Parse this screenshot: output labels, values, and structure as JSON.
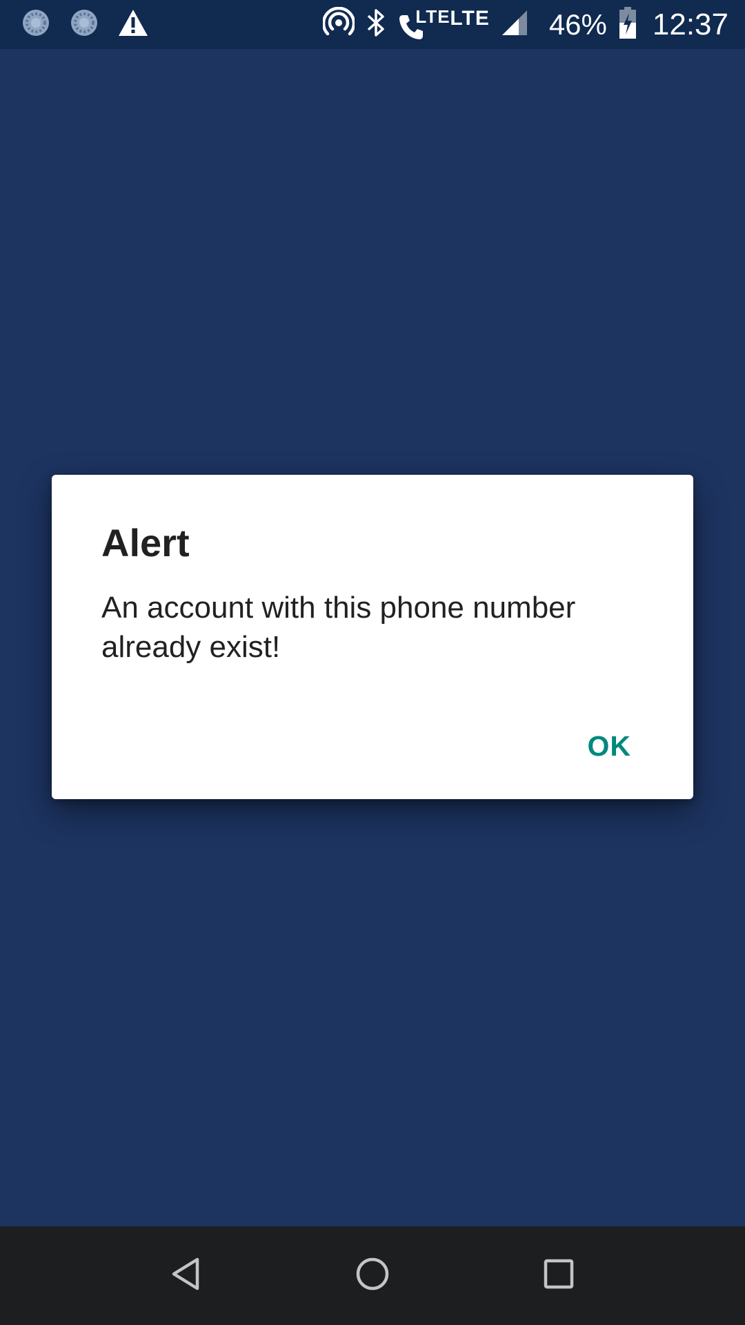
{
  "status_bar": {
    "icons_left": [
      "sync-icon",
      "sync-icon",
      "warning-icon"
    ],
    "icons_right": [
      "hotspot-icon",
      "bluetooth-icon",
      "volte-call-icon",
      "lte-icon",
      "signal-icon",
      "battery-charging-icon"
    ],
    "volte_label": "LTE",
    "lte_label": "LTE",
    "battery": "46%",
    "time": "12:37"
  },
  "dialog": {
    "title": "Alert",
    "message": "An account with this phone number already exist!",
    "ok_label": "OK"
  },
  "nav_bar": {
    "buttons": [
      "back-icon",
      "home-icon",
      "recents-icon"
    ]
  },
  "colors": {
    "status_bar": "#102a50",
    "app_background": "#1d3461",
    "dialog_background": "#ffffff",
    "accent": "#00897b",
    "nav_bar": "#1c1e20"
  }
}
